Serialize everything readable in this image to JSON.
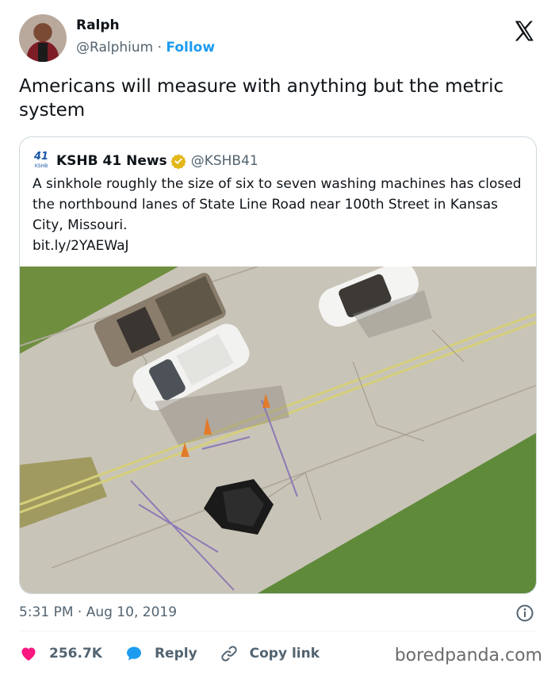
{
  "author": {
    "name": "Ralph",
    "handle": "@Ralphium",
    "separator": "·",
    "follow_label": "Follow"
  },
  "tweet": {
    "text": "Americans will measure with anything but the metric system"
  },
  "quoted": {
    "name": "KSHB 41 News",
    "handle": "@KSHB41",
    "logo_number": "41",
    "logo_sub": "KSHB",
    "text": "A sinkhole roughly the size of six to seven washing machines has closed the northbound lanes of State Line Road near 100th Street in Kansas City, Missouri.",
    "link": "bit.ly/2YAEWaJ"
  },
  "meta": {
    "timestamp": "5:31 PM · Aug 10, 2019"
  },
  "actions": {
    "likes": "256.7K",
    "reply_label": "Reply",
    "copy_label": "Copy link"
  },
  "watermark": "boredpanda.com",
  "icons": {
    "x_logo": "x-logo-icon",
    "verified": "verified-badge-icon",
    "info": "info-icon",
    "heart": "heart-icon",
    "reply": "reply-bubble-icon",
    "link": "link-icon"
  },
  "colors": {
    "accent": "#1d9bf0",
    "like": "#f91880",
    "secondary_text": "#536471",
    "border": "#cfd9de",
    "verified": "#e2b719"
  }
}
